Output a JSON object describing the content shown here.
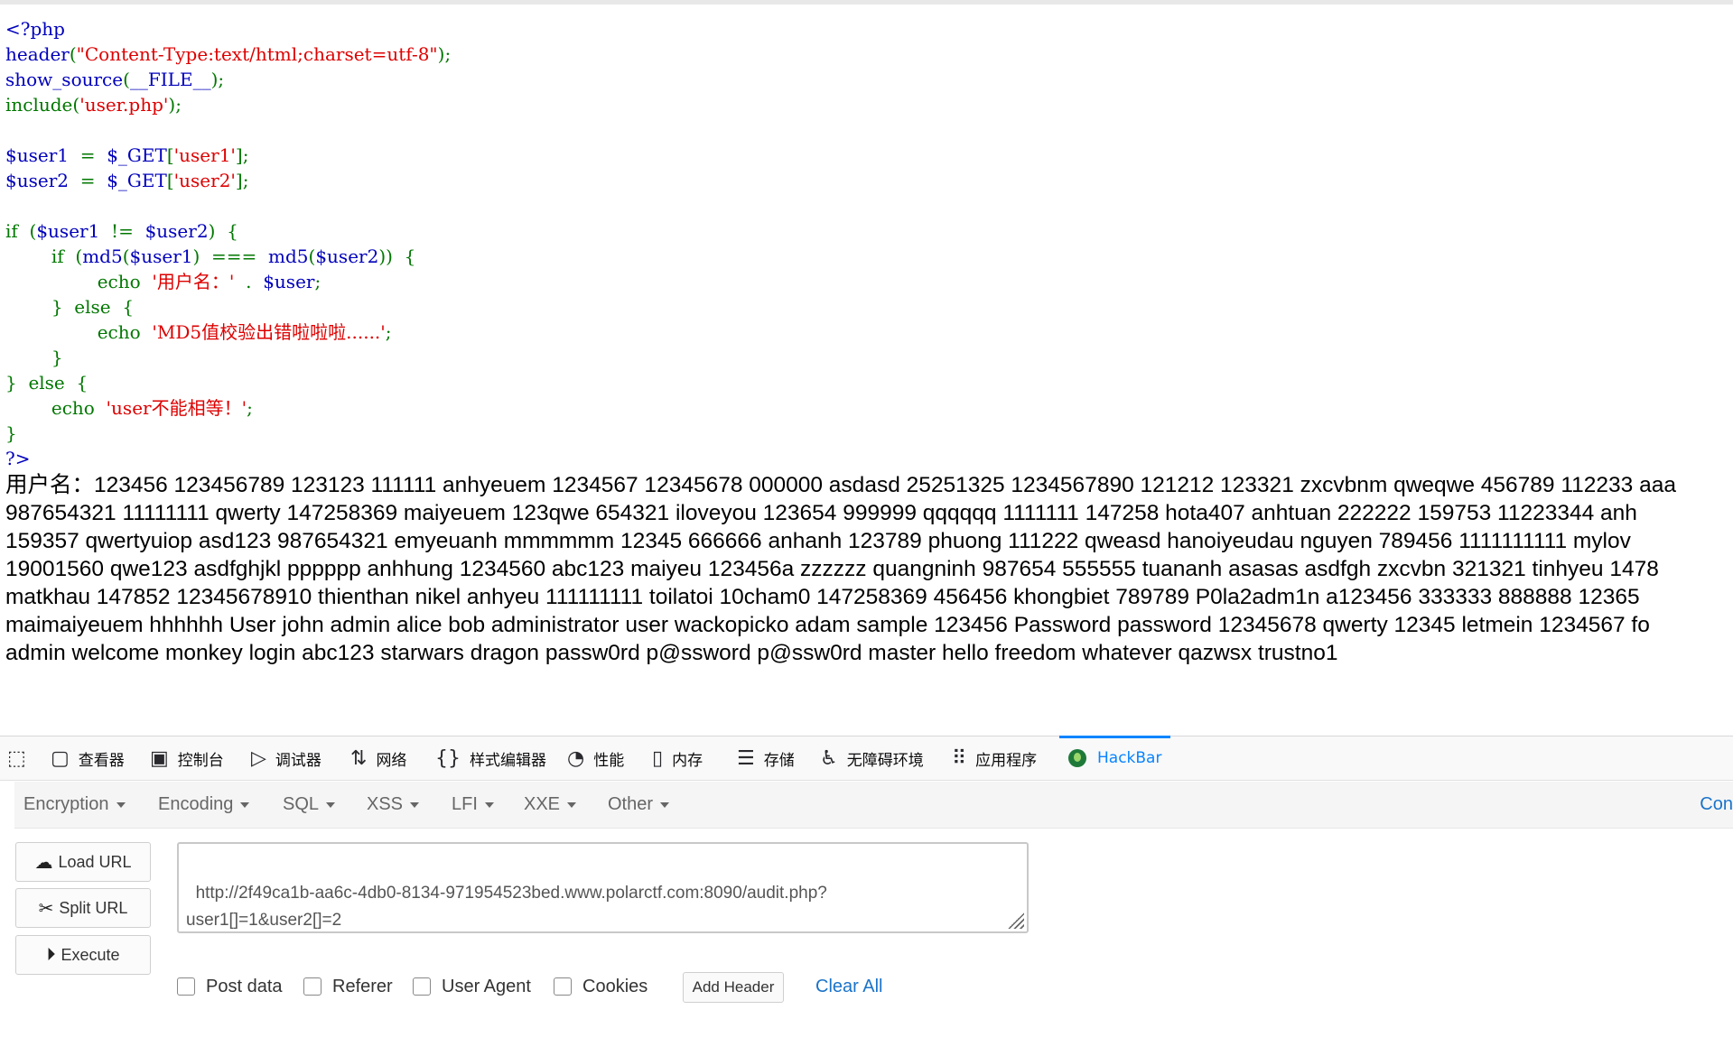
{
  "source": {
    "lines": [
      [
        {
          "t": "<?php",
          "c": "def"
        }
      ],
      [
        {
          "t": "header",
          "c": "def"
        },
        {
          "t": "(",
          "c": "kw"
        },
        {
          "t": "\"Content-Type:text/html;charset=utf-8\"",
          "c": "str"
        },
        {
          "t": ");",
          "c": "kw"
        }
      ],
      [
        {
          "t": "show_source",
          "c": "def"
        },
        {
          "t": "(",
          "c": "kw"
        },
        {
          "t": "__FILE__",
          "c": "def"
        },
        {
          "t": ");",
          "c": "kw"
        }
      ],
      [
        {
          "t": "include(",
          "c": "kw"
        },
        {
          "t": "'user.php'",
          "c": "str"
        },
        {
          "t": ");",
          "c": "kw"
        }
      ],
      [],
      [
        {
          "t": "$user1  ",
          "c": "def"
        },
        {
          "t": "=  ",
          "c": "kw"
        },
        {
          "t": "$_GET",
          "c": "def"
        },
        {
          "t": "[",
          "c": "kw"
        },
        {
          "t": "'user1'",
          "c": "str"
        },
        {
          "t": "];",
          "c": "kw"
        }
      ],
      [
        {
          "t": "$user2  ",
          "c": "def"
        },
        {
          "t": "=  ",
          "c": "kw"
        },
        {
          "t": "$_GET",
          "c": "def"
        },
        {
          "t": "[",
          "c": "kw"
        },
        {
          "t": "'user2'",
          "c": "str"
        },
        {
          "t": "];",
          "c": "kw"
        }
      ],
      [],
      [
        {
          "t": "if  (",
          "c": "kw"
        },
        {
          "t": "$user1  ",
          "c": "def"
        },
        {
          "t": "!=  ",
          "c": "kw"
        },
        {
          "t": "$user2",
          "c": "def"
        },
        {
          "t": ")  {",
          "c": "kw"
        }
      ],
      [
        {
          "t": "        if  (",
          "c": "kw"
        },
        {
          "t": "md5",
          "c": "def"
        },
        {
          "t": "(",
          "c": "kw"
        },
        {
          "t": "$user1",
          "c": "def"
        },
        {
          "t": ")  ===  ",
          "c": "kw"
        },
        {
          "t": "md5",
          "c": "def"
        },
        {
          "t": "(",
          "c": "kw"
        },
        {
          "t": "$user2",
          "c": "def"
        },
        {
          "t": "))  {",
          "c": "kw"
        }
      ],
      [
        {
          "t": "                echo  ",
          "c": "kw"
        },
        {
          "t": "'用户名：'",
          "c": "str"
        },
        {
          "t": "  .  ",
          "c": "kw"
        },
        {
          "t": "$user",
          "c": "def"
        },
        {
          "t": ";",
          "c": "kw"
        }
      ],
      [
        {
          "t": "        }  else  {",
          "c": "kw"
        }
      ],
      [
        {
          "t": "                echo  ",
          "c": "kw"
        },
        {
          "t": "'MD5值校验出错啦啦啦......'",
          "c": "str"
        },
        {
          "t": ";",
          "c": "kw"
        }
      ],
      [
        {
          "t": "        }",
          "c": "kw"
        }
      ],
      [
        {
          "t": "}  else  {",
          "c": "kw"
        }
      ],
      [
        {
          "t": "        echo  ",
          "c": "kw"
        },
        {
          "t": "'user不能相等！'",
          "c": "str"
        },
        {
          "t": ";",
          "c": "kw"
        }
      ],
      [
        {
          "t": "}",
          "c": "kw"
        }
      ],
      [
        {
          "t": "?>",
          "c": "def"
        }
      ]
    ]
  },
  "output": {
    "lines": [
      "用户名：123456 123456789 123123 111111 anhyeuem 1234567 12345678 000000 asdasd 25251325 1234567890 121212 123321 zxcvbnm qweqwe 456789 112233 aaa",
      "987654321 11111111 qwerty 147258369 maiyeuem 123qwe 654321 iloveyou 123654 999999 qqqqqq 1111111 147258 hota407 anhtuan 222222 159753 11223344 anh",
      "159357 qwertyuiop asd123 987654321 emyeuanh mmmmmm 12345 666666 anhanh 123789 phuong 111222 qweasd hanoiyeudau nguyen 789456 1111111111 mylov",
      "19001560 qwe123 asdfghjkl pppppp anhhung 1234560 abc123 maiyeu 123456a zzzzzz quangninh 987654 555555 tuananh asasas asdfgh zxcvbn 321321 tinhyeu 1478",
      "matkhau 147852 12345678910 thienthan nikel anhyeu 111111111 toilatoi 10cham0 147258369 456456 khongbiet 789789 P0la2adm1n a123456 333333 888888 12365",
      "maimaiyeuem hhhhhh User john admin alice bob administrator user wackopicko adam sample 123456 Password password 12345678 qwerty 12345 letmein 1234567 fo",
      "admin welcome monkey login abc123 starwars dragon passw0rd p@ssword p@ssw0rd master hello freedom whatever qazwsx trustno1"
    ]
  },
  "devtools": {
    "tabs": [
      {
        "label": "",
        "icon": "pick-element-icon",
        "glyph": "⬚"
      },
      {
        "label": "查看器",
        "icon": "inspector-icon",
        "glyph": "▢"
      },
      {
        "label": "控制台",
        "icon": "console-icon",
        "glyph": "▣"
      },
      {
        "label": "调试器",
        "icon": "debugger-icon",
        "glyph": "▷"
      },
      {
        "label": "网络",
        "icon": "network-icon",
        "glyph": "⇅"
      },
      {
        "label": "样式编辑器",
        "icon": "style-editor-icon",
        "glyph": "{}"
      },
      {
        "label": "性能",
        "icon": "performance-icon",
        "glyph": "◔"
      },
      {
        "label": "内存",
        "icon": "memory-icon",
        "glyph": "▯"
      },
      {
        "label": "存储",
        "icon": "storage-icon",
        "glyph": "☰"
      },
      {
        "label": "无障碍环境",
        "icon": "accessibility-icon",
        "glyph": "♿"
      },
      {
        "label": "应用程序",
        "icon": "application-icon",
        "glyph": "⠿"
      },
      {
        "label": "HackBar",
        "icon": "hackbar-logo-icon",
        "glyph": ""
      }
    ],
    "active_tab": "HackBar",
    "accent": "#0a84ff"
  },
  "hackbar": {
    "menu": [
      "Encryption",
      "Encoding",
      "SQL",
      "XSS",
      "LFI",
      "XXE",
      "Other"
    ],
    "contribute_label": "Con",
    "buttons": {
      "load": "Load URL",
      "split": "Split URL",
      "execute": "Execute"
    },
    "url": "http://2f49ca1b-aa6c-4db0-8134-971954523bed.www.polarctf.com:8090/audit.php?\nuser1[]=1&user2[]=2",
    "options": [
      "Post data",
      "Referer",
      "User Agent",
      "Cookies"
    ],
    "add_header": "Add Header",
    "clear_all": "Clear All"
  }
}
